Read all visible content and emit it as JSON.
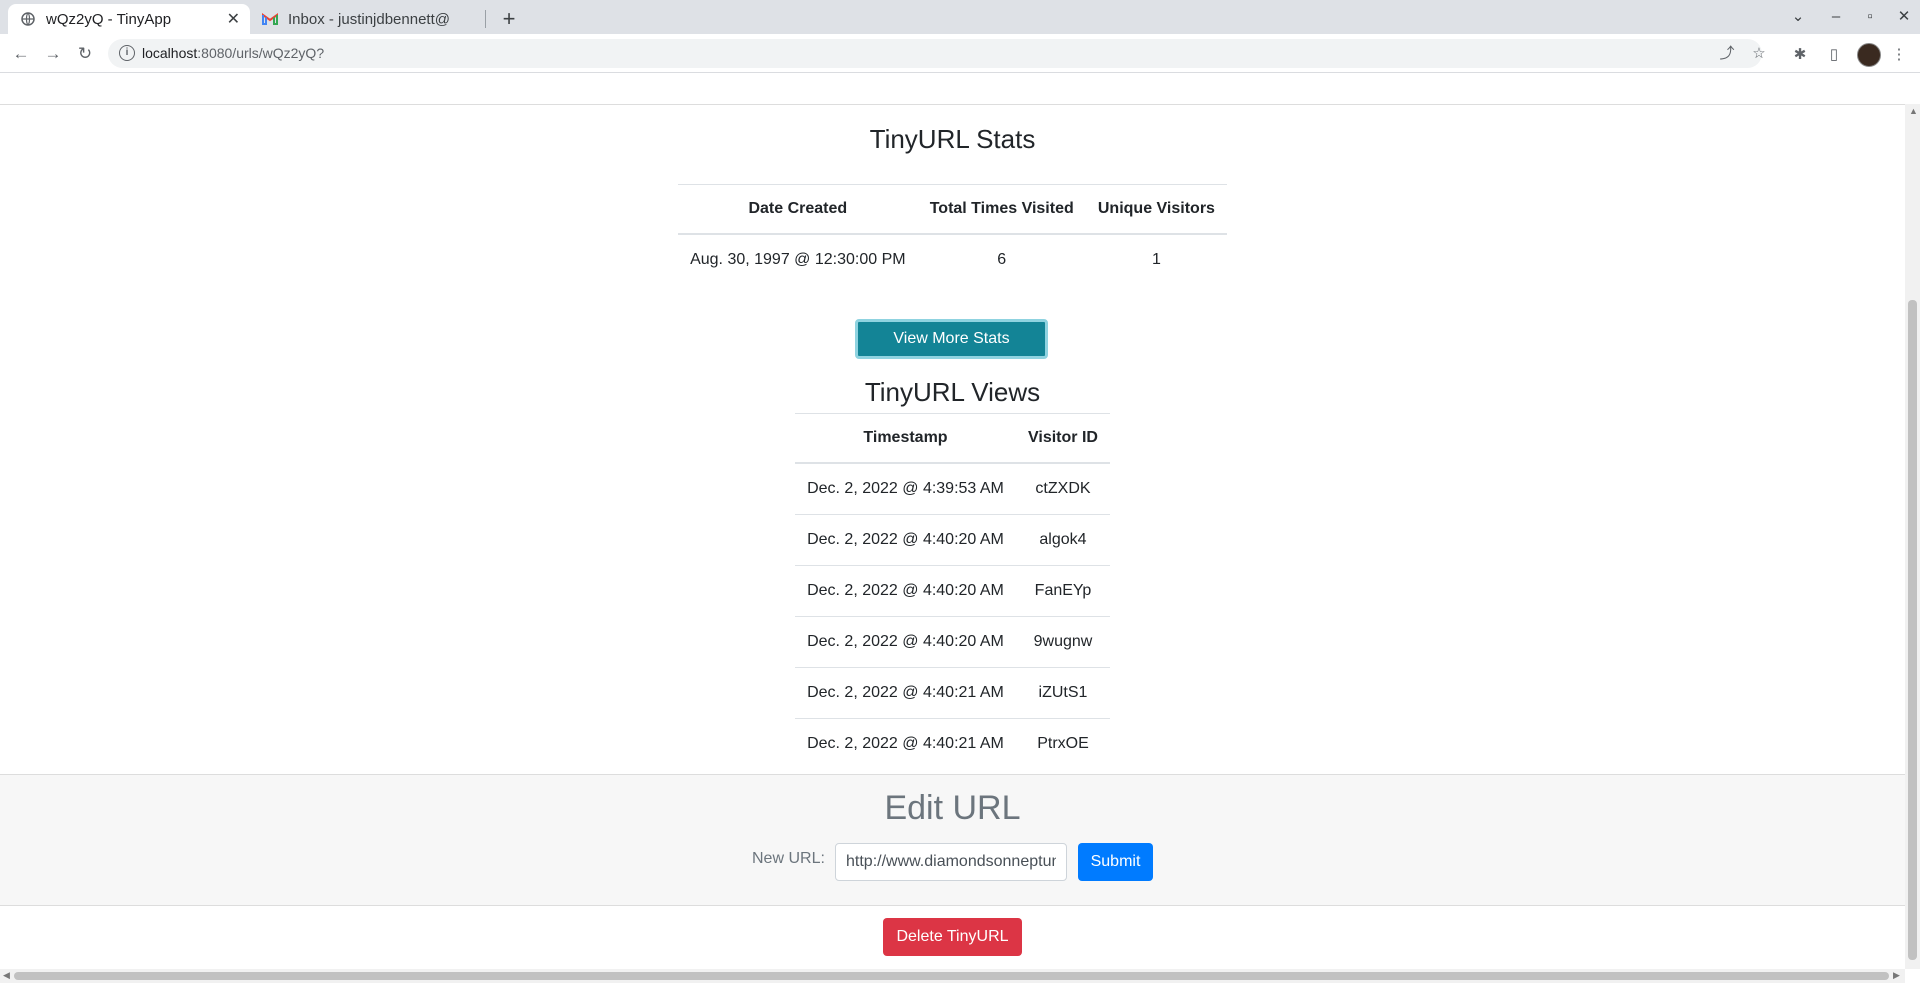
{
  "browser": {
    "active_tab_title": "wQz2yQ - TinyApp",
    "inactive_tab_title": "Inbox - justinjdbennett@",
    "url_host": "localhost",
    "url_path": ":8080/urls/wQz2yQ?"
  },
  "stats": {
    "title": "TinyURL Stats",
    "headers": [
      "Date Created",
      "Total Times Visited",
      "Unique Visitors"
    ],
    "row": [
      "Aug. 30, 1997 @ 12:30:00 PM",
      "6",
      "1"
    ],
    "view_more_label": "View More Stats"
  },
  "views": {
    "title": "TinyURL Views",
    "headers": [
      "Timestamp",
      "Visitor ID"
    ],
    "rows": [
      [
        "Dec. 2, 2022 @ 4:39:53 AM",
        "ctZXDK"
      ],
      [
        "Dec. 2, 2022 @ 4:40:20 AM",
        "algok4"
      ],
      [
        "Dec. 2, 2022 @ 4:40:20 AM",
        "FanEYp"
      ],
      [
        "Dec. 2, 2022 @ 4:40:20 AM",
        "9wugnw"
      ],
      [
        "Dec. 2, 2022 @ 4:40:21 AM",
        "iZUtS1"
      ],
      [
        "Dec. 2, 2022 @ 4:40:21 AM",
        "PtrxOE"
      ]
    ]
  },
  "edit": {
    "title": "Edit URL",
    "label": "New URL:",
    "value": "http://www.diamondsonneptune",
    "submit_label": "Submit"
  },
  "delete_label": "Delete TinyURL",
  "colors": {
    "view_more": "#138496",
    "submit": "#007bff",
    "delete": "#dc3545"
  }
}
